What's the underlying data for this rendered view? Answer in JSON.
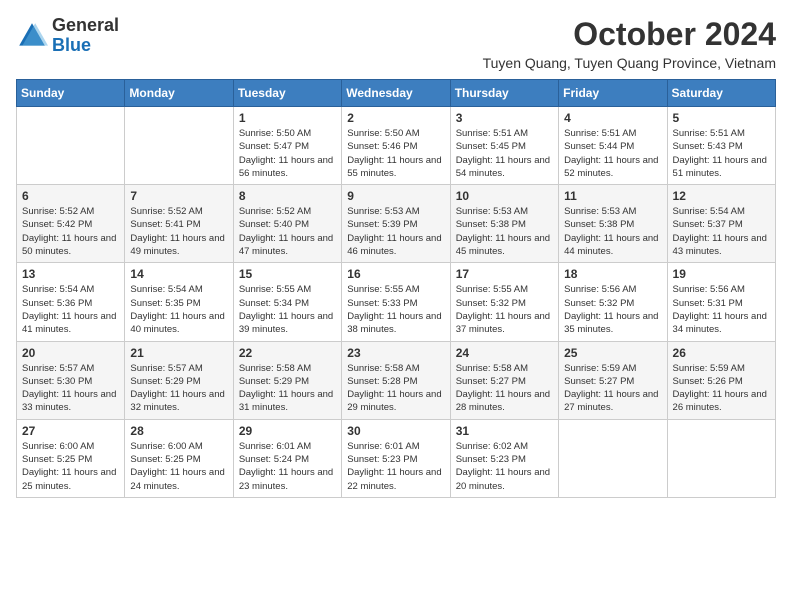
{
  "header": {
    "logo": {
      "general": "General",
      "blue": "Blue"
    },
    "title": "October 2024",
    "location": "Tuyen Quang, Tuyen Quang Province, Vietnam"
  },
  "weekdays": [
    "Sunday",
    "Monday",
    "Tuesday",
    "Wednesday",
    "Thursday",
    "Friday",
    "Saturday"
  ],
  "weeks": [
    [
      {
        "day": "",
        "sunrise": "",
        "sunset": "",
        "daylight": ""
      },
      {
        "day": "",
        "sunrise": "",
        "sunset": "",
        "daylight": ""
      },
      {
        "day": "1",
        "sunrise": "Sunrise: 5:50 AM",
        "sunset": "Sunset: 5:47 PM",
        "daylight": "Daylight: 11 hours and 56 minutes."
      },
      {
        "day": "2",
        "sunrise": "Sunrise: 5:50 AM",
        "sunset": "Sunset: 5:46 PM",
        "daylight": "Daylight: 11 hours and 55 minutes."
      },
      {
        "day": "3",
        "sunrise": "Sunrise: 5:51 AM",
        "sunset": "Sunset: 5:45 PM",
        "daylight": "Daylight: 11 hours and 54 minutes."
      },
      {
        "day": "4",
        "sunrise": "Sunrise: 5:51 AM",
        "sunset": "Sunset: 5:44 PM",
        "daylight": "Daylight: 11 hours and 52 minutes."
      },
      {
        "day": "5",
        "sunrise": "Sunrise: 5:51 AM",
        "sunset": "Sunset: 5:43 PM",
        "daylight": "Daylight: 11 hours and 51 minutes."
      }
    ],
    [
      {
        "day": "6",
        "sunrise": "Sunrise: 5:52 AM",
        "sunset": "Sunset: 5:42 PM",
        "daylight": "Daylight: 11 hours and 50 minutes."
      },
      {
        "day": "7",
        "sunrise": "Sunrise: 5:52 AM",
        "sunset": "Sunset: 5:41 PM",
        "daylight": "Daylight: 11 hours and 49 minutes."
      },
      {
        "day": "8",
        "sunrise": "Sunrise: 5:52 AM",
        "sunset": "Sunset: 5:40 PM",
        "daylight": "Daylight: 11 hours and 47 minutes."
      },
      {
        "day": "9",
        "sunrise": "Sunrise: 5:53 AM",
        "sunset": "Sunset: 5:39 PM",
        "daylight": "Daylight: 11 hours and 46 minutes."
      },
      {
        "day": "10",
        "sunrise": "Sunrise: 5:53 AM",
        "sunset": "Sunset: 5:38 PM",
        "daylight": "Daylight: 11 hours and 45 minutes."
      },
      {
        "day": "11",
        "sunrise": "Sunrise: 5:53 AM",
        "sunset": "Sunset: 5:38 PM",
        "daylight": "Daylight: 11 hours and 44 minutes."
      },
      {
        "day": "12",
        "sunrise": "Sunrise: 5:54 AM",
        "sunset": "Sunset: 5:37 PM",
        "daylight": "Daylight: 11 hours and 43 minutes."
      }
    ],
    [
      {
        "day": "13",
        "sunrise": "Sunrise: 5:54 AM",
        "sunset": "Sunset: 5:36 PM",
        "daylight": "Daylight: 11 hours and 41 minutes."
      },
      {
        "day": "14",
        "sunrise": "Sunrise: 5:54 AM",
        "sunset": "Sunset: 5:35 PM",
        "daylight": "Daylight: 11 hours and 40 minutes."
      },
      {
        "day": "15",
        "sunrise": "Sunrise: 5:55 AM",
        "sunset": "Sunset: 5:34 PM",
        "daylight": "Daylight: 11 hours and 39 minutes."
      },
      {
        "day": "16",
        "sunrise": "Sunrise: 5:55 AM",
        "sunset": "Sunset: 5:33 PM",
        "daylight": "Daylight: 11 hours and 38 minutes."
      },
      {
        "day": "17",
        "sunrise": "Sunrise: 5:55 AM",
        "sunset": "Sunset: 5:32 PM",
        "daylight": "Daylight: 11 hours and 37 minutes."
      },
      {
        "day": "18",
        "sunrise": "Sunrise: 5:56 AM",
        "sunset": "Sunset: 5:32 PM",
        "daylight": "Daylight: 11 hours and 35 minutes."
      },
      {
        "day": "19",
        "sunrise": "Sunrise: 5:56 AM",
        "sunset": "Sunset: 5:31 PM",
        "daylight": "Daylight: 11 hours and 34 minutes."
      }
    ],
    [
      {
        "day": "20",
        "sunrise": "Sunrise: 5:57 AM",
        "sunset": "Sunset: 5:30 PM",
        "daylight": "Daylight: 11 hours and 33 minutes."
      },
      {
        "day": "21",
        "sunrise": "Sunrise: 5:57 AM",
        "sunset": "Sunset: 5:29 PM",
        "daylight": "Daylight: 11 hours and 32 minutes."
      },
      {
        "day": "22",
        "sunrise": "Sunrise: 5:58 AM",
        "sunset": "Sunset: 5:29 PM",
        "daylight": "Daylight: 11 hours and 31 minutes."
      },
      {
        "day": "23",
        "sunrise": "Sunrise: 5:58 AM",
        "sunset": "Sunset: 5:28 PM",
        "daylight": "Daylight: 11 hours and 29 minutes."
      },
      {
        "day": "24",
        "sunrise": "Sunrise: 5:58 AM",
        "sunset": "Sunset: 5:27 PM",
        "daylight": "Daylight: 11 hours and 28 minutes."
      },
      {
        "day": "25",
        "sunrise": "Sunrise: 5:59 AM",
        "sunset": "Sunset: 5:27 PM",
        "daylight": "Daylight: 11 hours and 27 minutes."
      },
      {
        "day": "26",
        "sunrise": "Sunrise: 5:59 AM",
        "sunset": "Sunset: 5:26 PM",
        "daylight": "Daylight: 11 hours and 26 minutes."
      }
    ],
    [
      {
        "day": "27",
        "sunrise": "Sunrise: 6:00 AM",
        "sunset": "Sunset: 5:25 PM",
        "daylight": "Daylight: 11 hours and 25 minutes."
      },
      {
        "day": "28",
        "sunrise": "Sunrise: 6:00 AM",
        "sunset": "Sunset: 5:25 PM",
        "daylight": "Daylight: 11 hours and 24 minutes."
      },
      {
        "day": "29",
        "sunrise": "Sunrise: 6:01 AM",
        "sunset": "Sunset: 5:24 PM",
        "daylight": "Daylight: 11 hours and 23 minutes."
      },
      {
        "day": "30",
        "sunrise": "Sunrise: 6:01 AM",
        "sunset": "Sunset: 5:23 PM",
        "daylight": "Daylight: 11 hours and 22 minutes."
      },
      {
        "day": "31",
        "sunrise": "Sunrise: 6:02 AM",
        "sunset": "Sunset: 5:23 PM",
        "daylight": "Daylight: 11 hours and 20 minutes."
      },
      {
        "day": "",
        "sunrise": "",
        "sunset": "",
        "daylight": ""
      },
      {
        "day": "",
        "sunrise": "",
        "sunset": "",
        "daylight": ""
      }
    ]
  ]
}
